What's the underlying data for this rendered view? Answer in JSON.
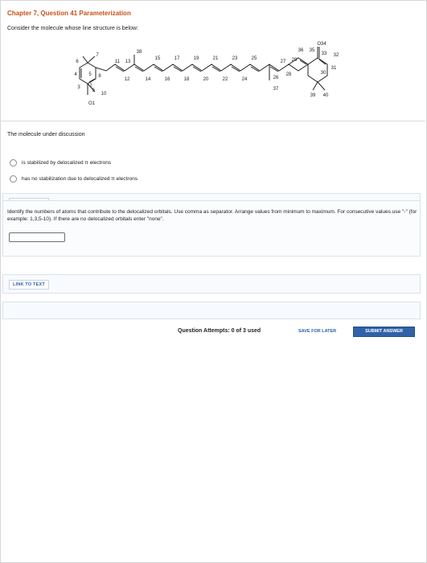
{
  "header": {
    "title": "Chapter 7, Question 41 Parameterization",
    "prompt": "Consider the molecule whose line structure is below:"
  },
  "molecule": {
    "atom_labels": [
      "1",
      "2",
      "3",
      "4",
      "5",
      "6",
      "7",
      "8",
      "9",
      "10",
      "11",
      "12",
      "13",
      "14",
      "15",
      "16",
      "17",
      "18",
      "19",
      "20",
      "21",
      "22",
      "23",
      "24",
      "25",
      "26",
      "27",
      "28",
      "29",
      "30",
      "31",
      "32",
      "33",
      "34",
      "35",
      "36",
      "37",
      "38",
      "39",
      "40"
    ],
    "oxygen_labels": [
      "O1",
      "O34"
    ]
  },
  "question1": {
    "text": "The molecule under discussion",
    "options": [
      "is stabilized by delocalized π electrons",
      "has no stabilization due to delocalized π electrons"
    ],
    "link_label": "LINK TO TEXT"
  },
  "question2": {
    "text": "Identify the numbers of atoms that contribute to the delocalized orbitals. Use comma as separator. Arrange values from minimum to maximum. For consecutive values use \"-\" (for example: 1,3,5-10). If there are no delocalized orbitals enter \"none\".",
    "input_value": "",
    "link_label": "LINK TO TEXT"
  },
  "footer": {
    "attempts": "Question Attempts: 0 of 3 used",
    "save_label": "SAVE FOR LATER",
    "submit_label": "SUBMIT ANSWER"
  },
  "colors": {
    "title": "#c8501a",
    "link": "#2b5fa0",
    "submit_bg": "#2f62a8",
    "section_border": "#d9e3ee"
  }
}
